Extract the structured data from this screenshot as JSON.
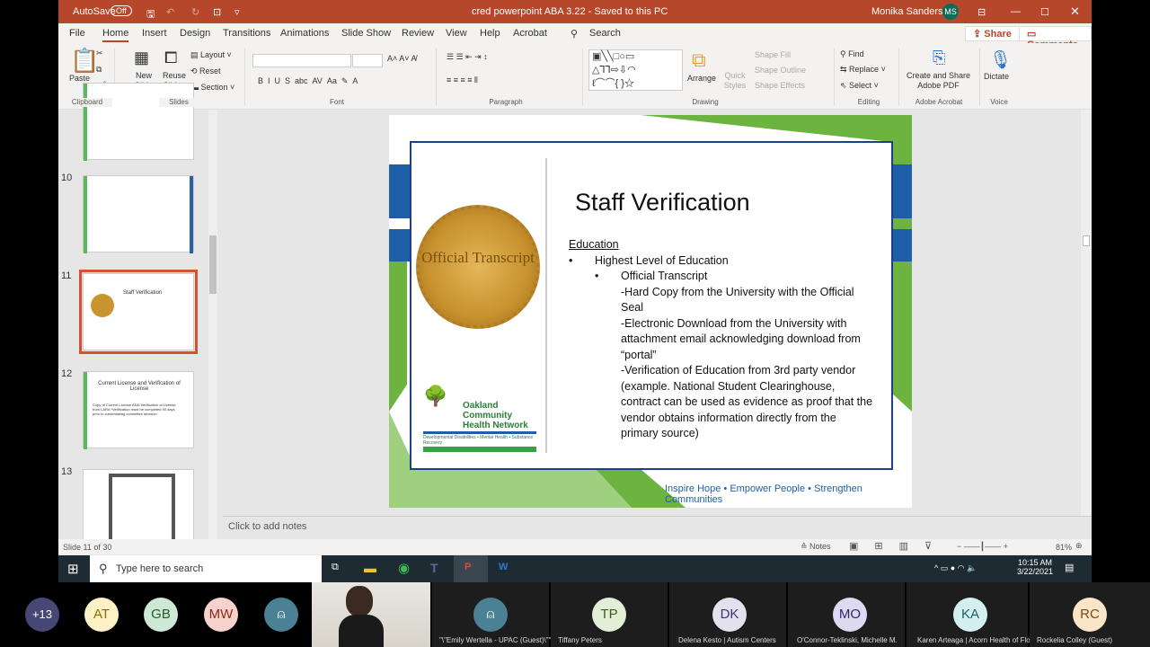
{
  "titlebar": {
    "autosave": "AutoSave",
    "autosave_state": "Off",
    "doc_title": "cred powerpoint ABA 3.22  -  Saved to this PC",
    "user": "Monika Sanders",
    "user_initials": "MS"
  },
  "tabs": [
    "File",
    "Home",
    "Insert",
    "Design",
    "Transitions",
    "Animations",
    "Slide Show",
    "Review",
    "View",
    "Help",
    "Acrobat"
  ],
  "search": "Search",
  "share": "Share",
  "comments": "Comments",
  "ribbon": {
    "paste": "Paste",
    "new_slide": "New Slide",
    "reuse_slides": "Reuse Slides",
    "layout": "Layout",
    "reset": "Reset",
    "section": "Section",
    "arrange": "Arrange",
    "quick_styles": "Quick Styles",
    "shape_fill": "Shape Fill",
    "shape_outline": "Shape Outline",
    "shape_effects": "Shape Effects",
    "find": "Find",
    "replace": "Replace",
    "select": "Select",
    "adobe": "Create and Share Adobe PDF",
    "dictate": "Dictate",
    "groups": [
      "Clipboard",
      "Slides",
      "Font",
      "Paragraph",
      "Drawing",
      "Editing",
      "Adobe Acrobat",
      "Voice"
    ]
  },
  "thumbnails": [
    {
      "num": "10"
    },
    {
      "num": "11",
      "title": "Staff Verification"
    },
    {
      "num": "12",
      "title": "Current License and Verification of License",
      "body": "Copy of Current License AND Verification of License from LARA *Verification must be completed 90 days prior to credentialing committee decision"
    },
    {
      "num": "13"
    }
  ],
  "slide": {
    "title": "Staff Verification",
    "seal_text": "Official Transcript",
    "section": "Education",
    "bullet1": "Highest Level of Education",
    "bullet2": "Official Transcript",
    "lines": [
      "-Hard Copy from the University with the Official Seal",
      "-Electronic Download from the University with attachment email acknowledging download from “portal”",
      "-Verification of Education from 3rd party vendor (example.  National Student Clearinghouse, contract can be used as evidence as proof that the vendor obtains information directly from the primary source)"
    ],
    "logo_name": "Oakland Community Health Network",
    "logo_tagline": "Developmental Disabilities • Mental Health • Substance Recovery",
    "footer": "Inspire Hope • Empower People • Strengthen Communities"
  },
  "notes_placeholder": "Click to add notes",
  "status": {
    "slide": "Slide 11 of 30",
    "notes": "Notes",
    "zoom": "81%"
  },
  "taskbar": {
    "search": "Type here to search",
    "time": "10:15 AM",
    "date": "3/22/2021"
  },
  "participants": [
    {
      "initials": "+13",
      "color": "#464775",
      "fg": "#fff"
    },
    {
      "initials": "AT",
      "color": "#fdf1c5",
      "fg": "#8a6d00"
    },
    {
      "initials": "GB",
      "color": "#cde8d5",
      "fg": "#245c35"
    },
    {
      "initials": "MW",
      "color": "#f5d3cc",
      "fg": "#8a2a1a"
    },
    {
      "initials": "",
      "color": "#4a8194",
      "fg": "#fff"
    }
  ],
  "tiles": [
    {
      "initials": "",
      "name": "\"\\\"Emily Wertella - UPAC (Guest)\\\"\"",
      "color": "#4a8194",
      "fg": "#fff"
    },
    {
      "initials": "TP",
      "name": "Tiffany Peters",
      "color": "#e2efd6",
      "fg": "#3c5a1e"
    },
    {
      "initials": "DK",
      "name": "Delena Kesto | Autism Centers",
      "color": "#e4e1ef",
      "fg": "#3d3570"
    },
    {
      "initials": "MO",
      "name": "O'Connor-Teklinski, Michelle M.",
      "color": "#dcd9f1",
      "fg": "#2f2a6a"
    },
    {
      "initials": "KA",
      "name": "Karen Arteaga | Acorn Health of Flo...",
      "color": "#d4eff0",
      "fg": "#1d6066"
    },
    {
      "initials": "RC",
      "name": "Rockelia Colley (Guest)",
      "color": "#fbe5c8",
      "fg": "#7a4a10"
    }
  ]
}
